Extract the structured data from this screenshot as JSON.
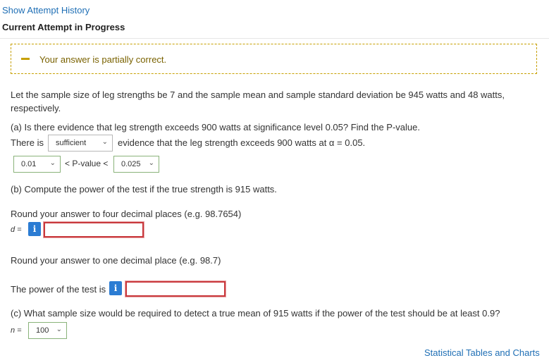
{
  "header": {
    "history_link": "Show Attempt History",
    "current_attempt": "Current Attempt in Progress"
  },
  "alert": {
    "message": "Your answer is partially correct.",
    "color": "#c7a000"
  },
  "problem": {
    "intro_line1": "Let the sample size of leg strengths be 7 and the sample mean and sample standard deviation be 945 watts and 48 watts,",
    "intro_line2": "respectively.",
    "part_a": {
      "question": "(a) Is there evidence that leg strength exceeds 900 watts at significance level 0.05? Find the P-value.",
      "prefix": "There is",
      "evidence_select": "sufficient",
      "suffix": "evidence that the leg strength exceeds 900 watts at α = 0.05.",
      "lower_select": "0.01",
      "middle_text": "< P-value <",
      "upper_select": "0.025"
    },
    "part_b": {
      "question": "(b) Compute the power of the test if the true strength is 915 watts.",
      "round4": "Round your answer to four decimal places (e.g. 98.7654)",
      "d_label": "d =",
      "d_value": "",
      "round1": "Round your answer to one decimal place (e.g. 98.7)",
      "power_label": "The power of the test is",
      "power_value": ""
    },
    "part_c": {
      "question": "(c) What sample size would be required to detect a true mean of 915 watts if the power of the test should be at least 0.9?",
      "n_label": "n =",
      "n_select": "100"
    }
  },
  "footer": {
    "tables_link": "Statistical Tables and Charts"
  },
  "icons": {
    "info": "i",
    "chevron": "⌄"
  }
}
